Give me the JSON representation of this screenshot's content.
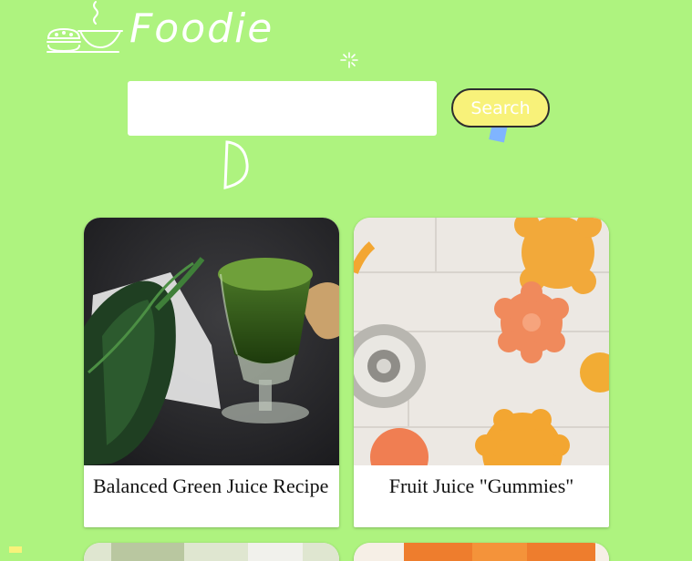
{
  "header": {
    "brand": "Foodie"
  },
  "search": {
    "placeholder": "",
    "value": "",
    "button_label": "Search"
  },
  "recipes": [
    {
      "title": "Balanced Green Juice Recipe"
    },
    {
      "title": "Fruit Juice \"Gummies\""
    }
  ],
  "colors": {
    "background": "#aef37f",
    "button": "#f8f27a",
    "accent_blue": "#7fb4ff"
  },
  "icons": [
    "food-logo-icon",
    "sparkle-icon",
    "d-doodle-icon"
  ]
}
